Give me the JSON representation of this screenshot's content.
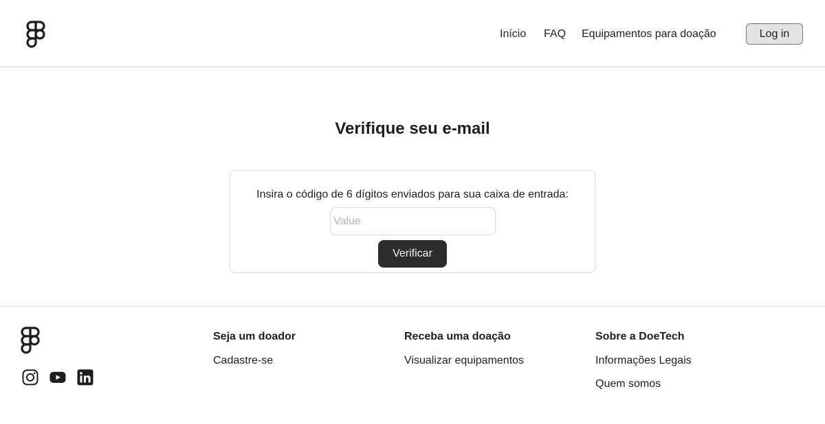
{
  "header": {
    "nav": [
      "Início",
      "FAQ",
      "Equipamentos para doação"
    ],
    "login_label": "Log in"
  },
  "main": {
    "title": "Verifique seu e-mail",
    "instruction": "Insira o código de 6 dígitos enviados para sua caixa de entrada:",
    "code_input": {
      "placeholder": "Value",
      "value": ""
    },
    "verify_label": "Verificar"
  },
  "footer": {
    "social_icons": [
      "instagram-icon",
      "youtube-icon",
      "linkedin-icon"
    ],
    "columns": [
      {
        "title": "Seja um doador",
        "links": [
          "Cadastre-se"
        ]
      },
      {
        "title": "Receba uma doação",
        "links": [
          "Visualizar equipamentos"
        ]
      },
      {
        "title": "Sobre a DoeTech",
        "links": [
          "Informações Legais",
          "Quem somos"
        ]
      }
    ]
  },
  "colors": {
    "text": "#1e1e1e",
    "primary_button": "#2c2c2c",
    "secondary_button": "#e3e3e3",
    "border": "#d9d9d9",
    "placeholder": "#b3b3b3"
  }
}
